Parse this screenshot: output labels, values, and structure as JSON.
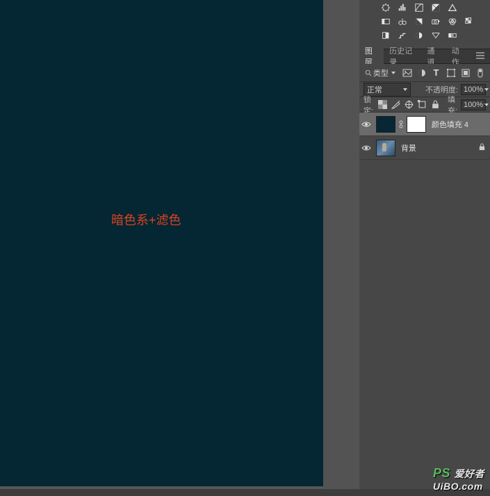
{
  "canvas": {
    "annotation": "暗色系+滤色"
  },
  "panel_tabs": {
    "layers": "图层",
    "history": "历史记录",
    "channels": "通道",
    "actions": "动作"
  },
  "filter_row": {
    "kind_label": "类型"
  },
  "blend_row": {
    "mode": "正常",
    "opacity_label": "不透明度:",
    "opacity_value": "100%"
  },
  "lock_row": {
    "lock_label": "锁定:",
    "fill_label": "填充:",
    "fill_value": "100%"
  },
  "layers": [
    {
      "name": "颜色填充 4",
      "selected": true,
      "has_mask": true,
      "locked": false,
      "thumb": "fill-dark"
    },
    {
      "name": "背景",
      "selected": false,
      "has_mask": false,
      "locked": true,
      "thumb": "photo"
    }
  ],
  "watermark": {
    "ps": "PS",
    "txt": "爱好者",
    "url": "UiBO.com"
  }
}
